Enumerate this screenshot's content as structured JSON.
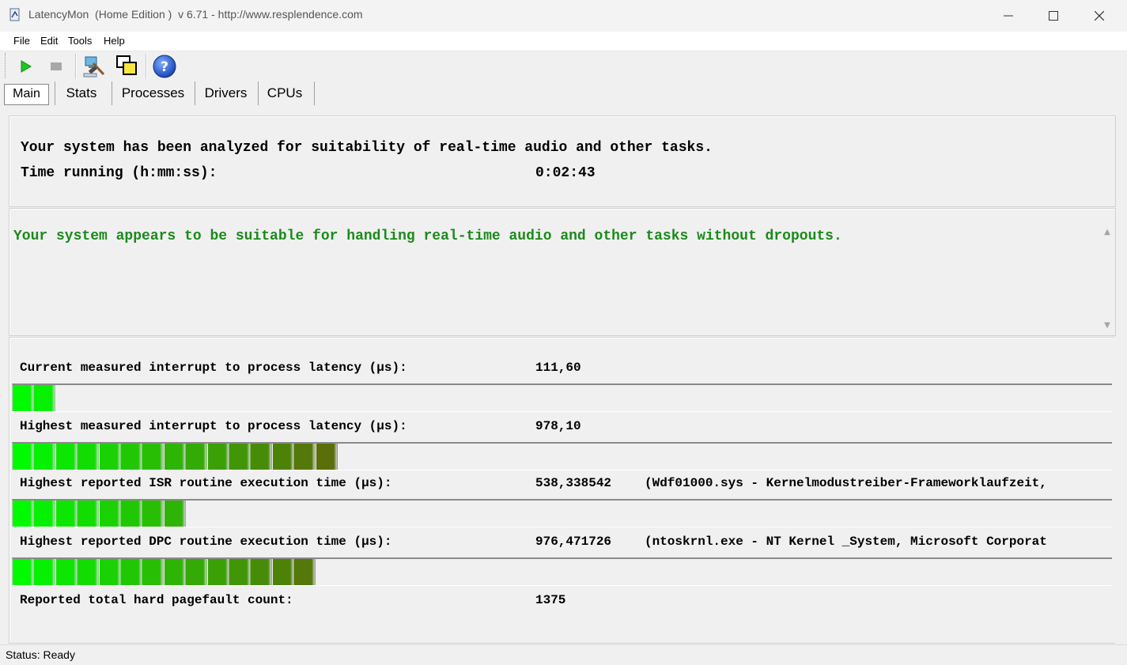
{
  "window": {
    "title": "LatencyMon  (Home Edition )  v 6.71 - http://www.resplendence.com",
    "minimize_icon": "minimize-icon",
    "maximize_icon": "maximize-icon",
    "close_icon": "close-icon"
  },
  "menu": [
    "File",
    "Edit",
    "Tools",
    "Help"
  ],
  "toolbar": {
    "icons": [
      "play-icon",
      "stop-icon",
      "hammer-monitor-icon",
      "windows-icon",
      "help-icon"
    ]
  },
  "tabs": [
    "Main",
    "Stats",
    "Processes",
    "Drivers",
    "CPUs"
  ],
  "active_tab": "Main",
  "summary": {
    "line1": "Your system has been analyzed for suitability of real-time audio and other tasks.",
    "time_label": "Time running (h:mm:ss):",
    "time_value": "0:02:43"
  },
  "verdict": {
    "text": "Your system appears to be suitable for handling real-time audio and other tasks without dropouts.",
    "color": "#1a8a1a"
  },
  "metrics": [
    {
      "label": "Current measured interrupt to process latency (µs):",
      "value": "111,60",
      "detail": "",
      "bar_segments": 2
    },
    {
      "label": "Highest measured interrupt to process latency (µs):",
      "value": "978,10",
      "detail": "",
      "bar_segments": 15
    },
    {
      "label": "Highest reported ISR routine execution time (µs):",
      "value": "538,338542",
      "detail": "(Wdf01000.sys - Kernelmodustreiber-Frameworklaufzeit,",
      "bar_segments": 8
    },
    {
      "label": "Highest reported DPC routine execution time (µs):",
      "value": "976,471726",
      "detail": "(ntoskrnl.exe - NT Kernel _System, Microsoft Corporat",
      "bar_segments": 14
    }
  ],
  "pagefault": {
    "label": "Reported total hard pagefault count:",
    "value": "1375"
  },
  "status": "Status: Ready"
}
